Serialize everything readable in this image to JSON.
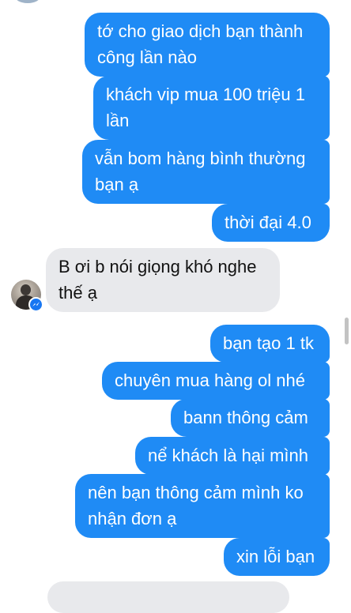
{
  "messages": {
    "m1": "tớ cho giao dịch bạn thành công lần nào",
    "m2": "khách vip mua 100 triệu 1 lần",
    "m3": "vẫn bom hàng bình thường bạn ạ",
    "m4": "thời đại 4.0",
    "m5": "B ơi b nói giọng khó nghe thế ạ",
    "m6": "bạn tạo 1 tk",
    "m7": "chuyên mua hàng ol nhé",
    "m8": "bann thông cảm",
    "m9": "nể khách là hại mình",
    "m10": "nên bạn thông cảm mình ko nhận đơn ạ",
    "m11": "xin lỗi bạn"
  },
  "colors": {
    "outgoing_bubble": "#1f8bf5",
    "incoming_bubble": "#e8e9ec",
    "messenger_badge": "#1877f2"
  },
  "icons": {
    "sender_avatar": "avatar",
    "badge": "messenger-icon"
  }
}
